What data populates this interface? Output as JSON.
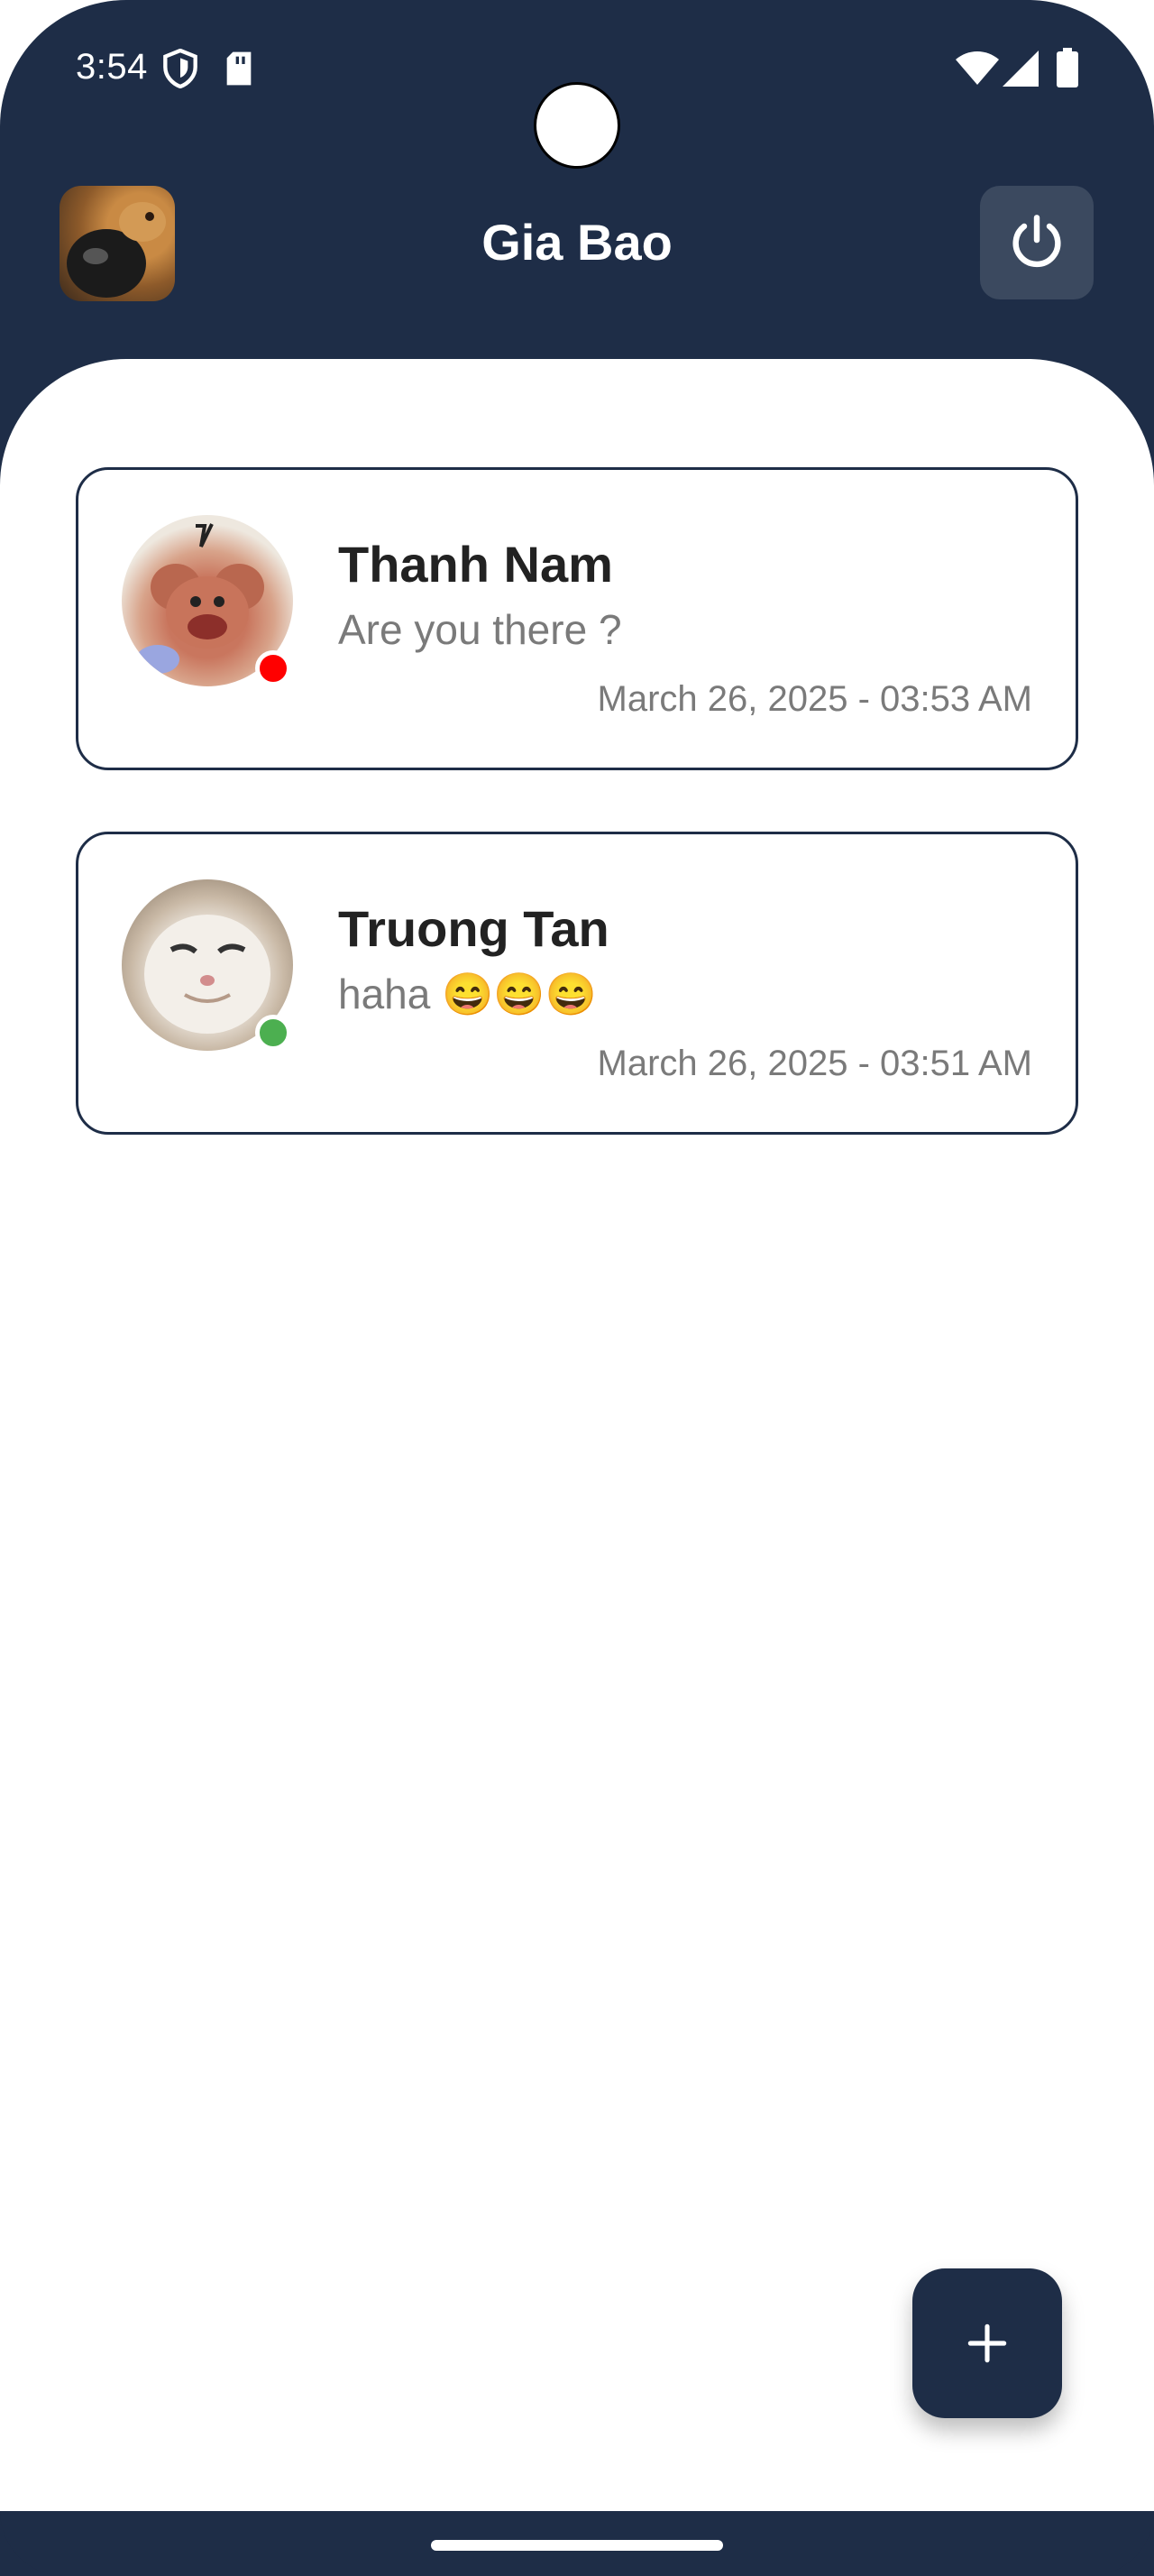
{
  "status_bar": {
    "time": "3:54",
    "icons": [
      "shield-icon",
      "sd-card-icon",
      "wifi-icon",
      "signal-icon",
      "battery-icon"
    ]
  },
  "header": {
    "title": "Gia Bao",
    "avatar_icon": "profile-avatar",
    "power_icon": "power-icon"
  },
  "chats": [
    {
      "name": "Thanh Nam",
      "message": "Are you there ?",
      "time": "March 26, 2025 - 03:53 AM",
      "status": "offline",
      "status_color": "#ff0000"
    },
    {
      "name": "Truong Tan",
      "message": "haha 😄😄😄",
      "time": "March 26, 2025 - 03:51 AM",
      "status": "online",
      "status_color": "#4caf50"
    }
  ],
  "fab": {
    "icon": "plus-icon"
  },
  "colors": {
    "primary": "#1e2d47",
    "power_button_bg": "#3b495f",
    "text_primary": "#222222",
    "text_secondary": "#7a7a7a"
  }
}
